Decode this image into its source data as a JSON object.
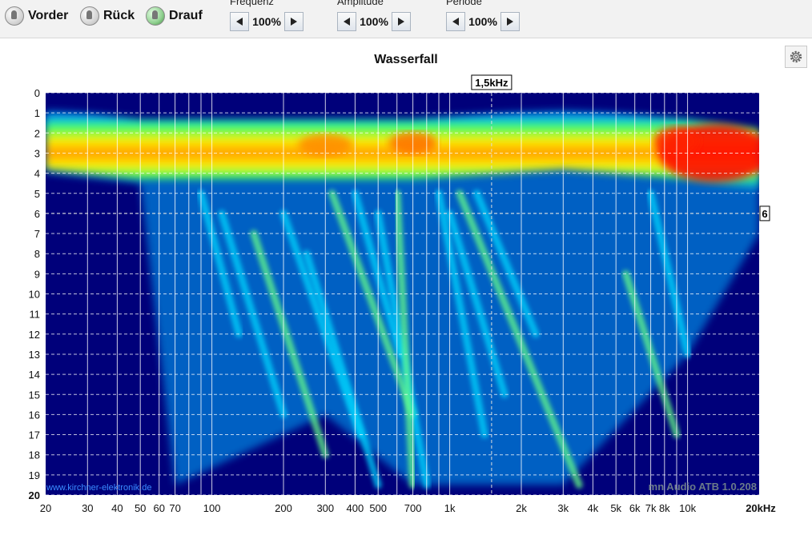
{
  "toolbar": {
    "views": [
      {
        "label": "Vorder",
        "icon": "hand-front-icon"
      },
      {
        "label": "Rück",
        "icon": "hand-back-icon"
      },
      {
        "label": "Drauf",
        "icon": "hand-top-icon"
      }
    ],
    "controls": [
      {
        "label": "Frequenz",
        "value": "100%"
      },
      {
        "label": "Amplitude",
        "value": "100%"
      },
      {
        "label": "Periode",
        "value": "100%"
      }
    ]
  },
  "chart": {
    "settings_icon": "gear-icon",
    "cursor_freq_label": "1,5kHz",
    "cursor_period_label": "6",
    "watermark_left": "www.kirchner-elektronik.de",
    "watermark_right": "mn Audio ATB 1.0.208"
  },
  "chart_data": {
    "type": "heatmap",
    "title": "Wasserfall",
    "x_scale": "log",
    "x_ticks": [
      "20",
      "30",
      "40",
      "50",
      "60",
      "70",
      "100",
      "200",
      "300",
      "400",
      "500",
      "700",
      "1k",
      "2k",
      "3k",
      "4k",
      "5k",
      "6k",
      "7k",
      "8k",
      "10k",
      "20kHz"
    ],
    "x_tick_values": [
      20,
      30,
      40,
      50,
      60,
      70,
      100,
      200,
      300,
      400,
      500,
      700,
      1000,
      2000,
      3000,
      4000,
      5000,
      6000,
      7000,
      8000,
      10000,
      20000
    ],
    "y_ticks": [
      "0",
      "1",
      "2",
      "3",
      "4",
      "5",
      "6",
      "7",
      "8",
      "9",
      "10",
      "11",
      "12",
      "13",
      "14",
      "15",
      "16",
      "17",
      "18",
      "19",
      "20"
    ],
    "ylim": [
      0,
      20
    ],
    "xlim": [
      20,
      20000
    ],
    "cursor": {
      "frequency_hz": 1500,
      "period": 6
    },
    "colormap": [
      "#00007a",
      "#0033ff",
      "#00ccff",
      "#00ff88",
      "#66ff00",
      "#ffff00",
      "#ff8800",
      "#ff0000"
    ],
    "intensity_profile": [
      {
        "frequency_hz": 20,
        "ridge_period": 2.0,
        "decay_end_period": 4.0
      },
      {
        "frequency_hz": 50,
        "ridge_period": 2.5,
        "decay_end_period": 4.5
      },
      {
        "frequency_hz": 70,
        "ridge_period": 2.5,
        "decay_end_period": 19.5
      },
      {
        "frequency_hz": 300,
        "ridge_period": 2.5,
        "decay_end_period": 16.0
      },
      {
        "frequency_hz": 700,
        "ridge_period": 2.5,
        "decay_end_period": 19.5
      },
      {
        "frequency_hz": 3000,
        "ridge_period": 2.0,
        "decay_end_period": 19.5
      },
      {
        "frequency_hz": 10000,
        "ridge_period": 2.5,
        "decay_end_period": 13.0
      },
      {
        "frequency_hz": 20000,
        "ridge_period": 3.0,
        "decay_end_period": 7.0
      }
    ]
  }
}
